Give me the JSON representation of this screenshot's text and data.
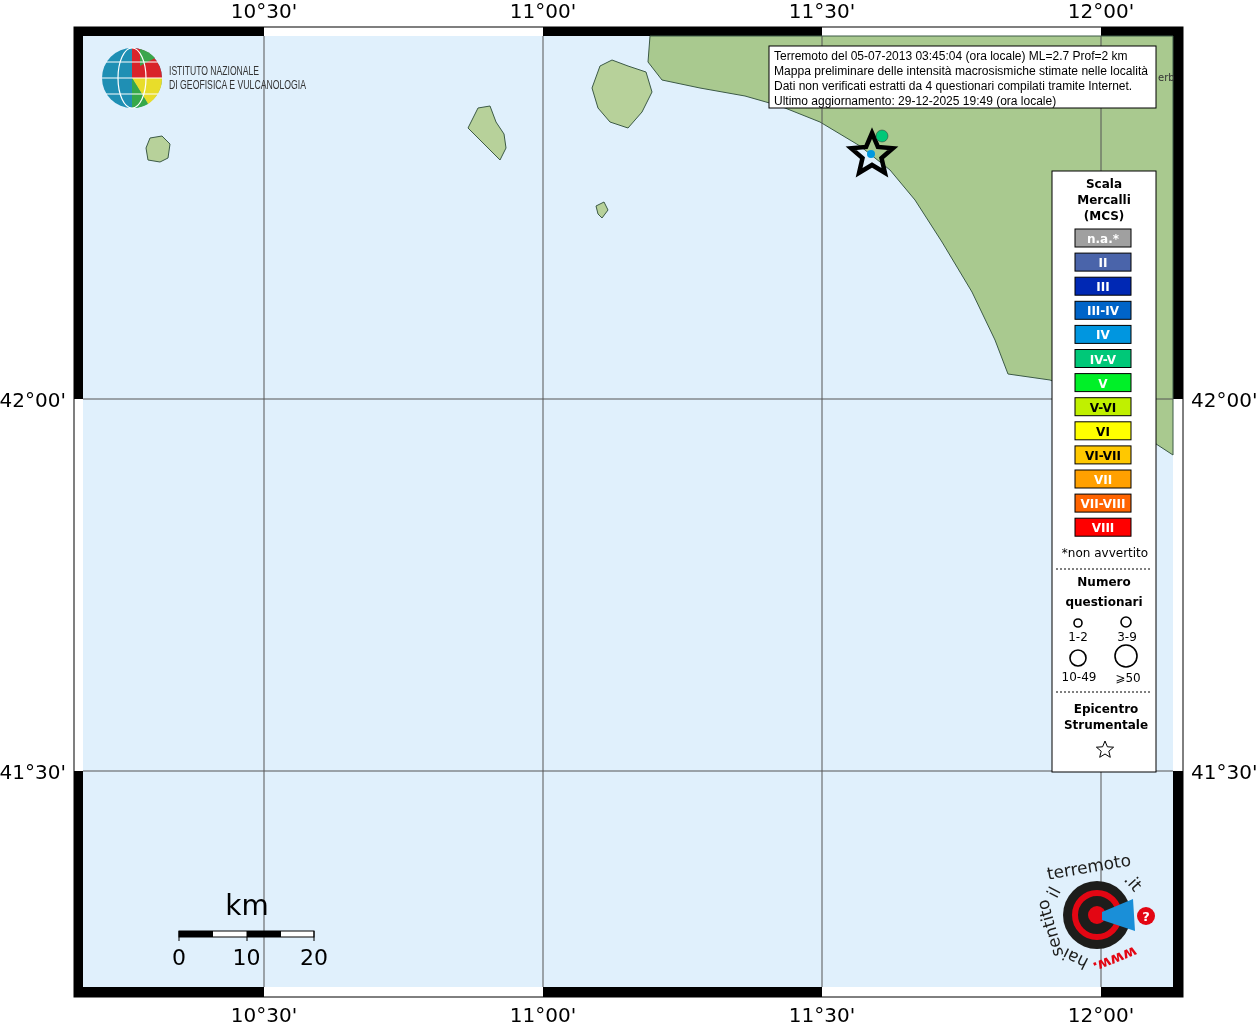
{
  "map": {
    "top_labels": [
      "10°30'",
      "11°00'",
      "11°30'",
      "12°00'"
    ],
    "bottom_labels": [
      "10°30'",
      "11°00'",
      "11°30'",
      "12°00'"
    ],
    "left_labels": [
      "42°00'",
      "41°30'"
    ],
    "right_labels": [
      "42°00'",
      "41°30'"
    ],
    "place_labels": [
      "erb"
    ],
    "points": [
      {
        "color": "#00c878"
      },
      {
        "color": "#0099e0"
      }
    ]
  },
  "institute_logo": {
    "lines": [
      "ISTITUTO NAZIONALE",
      "DI GEOFISICA E VULCANOLOGIA"
    ]
  },
  "info_box": {
    "lines": [
      "Terremoto del 05-07-2013 03:45:04 (ora locale) ML=2.7 Prof=2 km",
      "Mappa preliminare delle intensità macrosismiche stimate nelle località",
      "Dati non verificati estratti da 4 questionari compilati tramite Internet.",
      "Ultimo aggiornamento: 29-12-2025 19:49 (ora locale)"
    ]
  },
  "legend": {
    "title": [
      "Scala",
      "Mercalli",
      "(MCS)"
    ],
    "items": [
      {
        "label": "n.a.*",
        "color": "#a0a0a0"
      },
      {
        "label": "II",
        "color": "#4a64aa"
      },
      {
        "label": "III",
        "color": "#0028b4"
      },
      {
        "label": "III-IV",
        "color": "#0064c8"
      },
      {
        "label": "IV",
        "color": "#0096e0"
      },
      {
        "label": "IV-V",
        "color": "#00c878"
      },
      {
        "label": "V",
        "color": "#00f028"
      },
      {
        "label": "V-VI",
        "color": "#c0f000"
      },
      {
        "label": "VI",
        "color": "#ffff00"
      },
      {
        "label": "VI-VII",
        "color": "#ffc800"
      },
      {
        "label": "VII",
        "color": "#ffa000"
      },
      {
        "label": "VII-VIII",
        "color": "#ff6400"
      },
      {
        "label": "VIII",
        "color": "#ff0000"
      }
    ],
    "note": "*non avvertito",
    "count_title": [
      "Numero",
      "questionari"
    ],
    "counts": [
      "1-2",
      "3-9",
      "10-49",
      "⩾50"
    ],
    "epicenter_title": [
      "Epicentro",
      "Strumentale"
    ]
  },
  "scale_bar": {
    "unit": "km",
    "ticks": [
      "0",
      "10",
      "20"
    ]
  },
  "site_logo": {
    "words": [
      "hai",
      "sentito",
      "il",
      "terremoto",
      ".it"
    ],
    "prefix": "www.",
    "badge": "?"
  }
}
